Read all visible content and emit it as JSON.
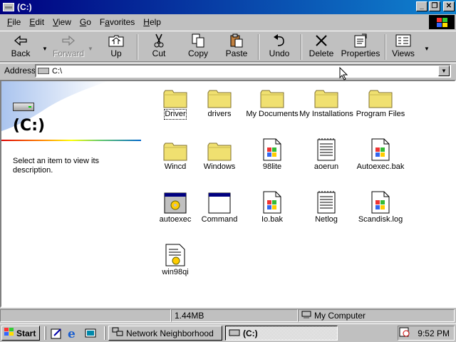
{
  "window": {
    "title": "(C:)",
    "controls": {
      "minimize": "_",
      "restore": "❐",
      "close": "✕"
    }
  },
  "menu": [
    "File",
    "Edit",
    "View",
    "Go",
    "Favorites",
    "Help"
  ],
  "menu_underline": [
    "F",
    "E",
    "V",
    "G",
    "a",
    "H"
  ],
  "toolbar": {
    "back": "Back",
    "forward": "Forward",
    "up": "Up",
    "cut": "Cut",
    "copy": "Copy",
    "paste": "Paste",
    "undo": "Undo",
    "delete": "Delete",
    "properties": "Properties",
    "views": "Views"
  },
  "address": {
    "label": "Address",
    "value": "C:\\"
  },
  "left_pane": {
    "title": "(C:)",
    "description": "Select an item to view its description."
  },
  "items": [
    {
      "name": "Driver",
      "icon": "folder-icon",
      "selected": true
    },
    {
      "name": "drivers",
      "icon": "folder-icon"
    },
    {
      "name": "My Documents",
      "icon": "folder-icon"
    },
    {
      "name": "My Installations",
      "icon": "folder-icon"
    },
    {
      "name": "Program Files",
      "icon": "folder-icon"
    },
    {
      "name": "Wincd",
      "icon": "folder-icon"
    },
    {
      "name": "Windows",
      "icon": "folder-icon"
    },
    {
      "name": "98lite",
      "icon": "windows-file-icon"
    },
    {
      "name": "aoerun",
      "icon": "notepad-file-icon"
    },
    {
      "name": "Autoexec.bak",
      "icon": "windows-file-icon"
    },
    {
      "name": "autoexec",
      "icon": "batch-file-icon"
    },
    {
      "name": "Command",
      "icon": "program-window-icon"
    },
    {
      "name": "Io.bak",
      "icon": "windows-file-icon"
    },
    {
      "name": "Netlog",
      "icon": "notepad-file-icon"
    },
    {
      "name": "Scandisk.log",
      "icon": "windows-file-icon"
    },
    {
      "name": "win98qi",
      "icon": "settings-file-icon"
    }
  ],
  "status": {
    "size": "1.44MB",
    "zone": "My Computer"
  },
  "taskbar": {
    "start": "Start",
    "tasks": [
      {
        "label": "Network Neighborhood",
        "active": false
      },
      {
        "label": "(C:)",
        "active": true
      }
    ],
    "clock": "9:52 PM"
  },
  "colors": {
    "titlebar": "#000080",
    "desktop": "#008080",
    "face": "#c0c0c0",
    "folder": "#f0e070"
  }
}
